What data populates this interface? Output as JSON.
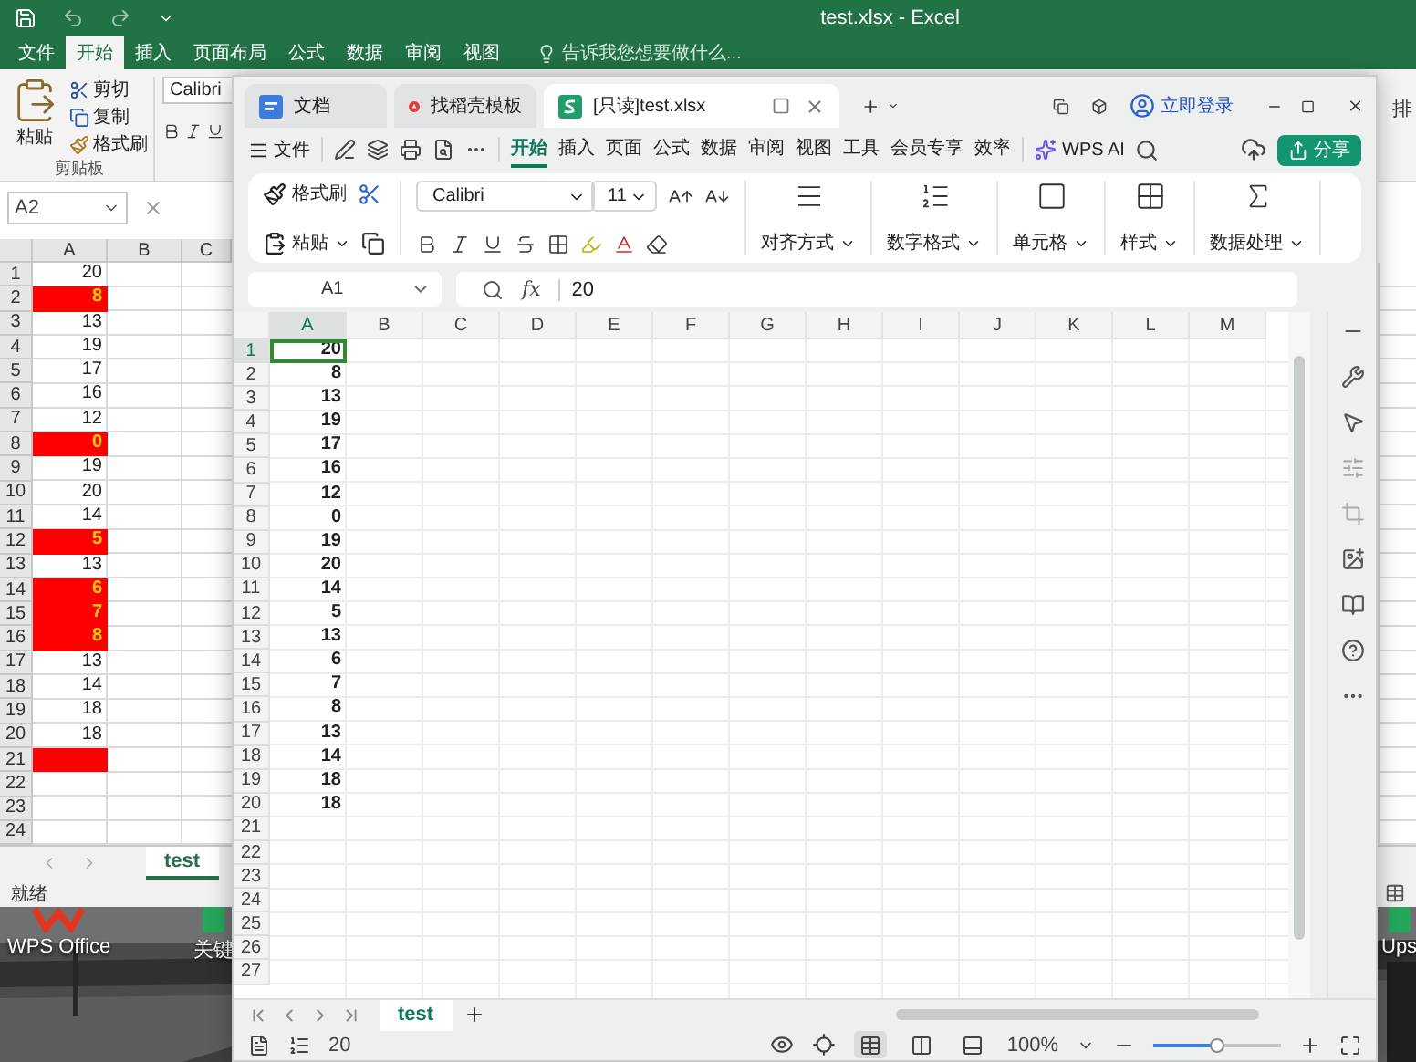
{
  "excel": {
    "title": "test.xlsx - Excel",
    "tabs": [
      {
        "label": "文件",
        "selected": false
      },
      {
        "label": "开始",
        "selected": true
      },
      {
        "label": "插入",
        "selected": false
      },
      {
        "label": "页面布局",
        "selected": false
      },
      {
        "label": "公式",
        "selected": false
      },
      {
        "label": "数据",
        "selected": false
      },
      {
        "label": "审阅",
        "selected": false
      },
      {
        "label": "视图",
        "selected": false
      }
    ],
    "tell_me": "告诉我您想要做什么...",
    "paste": "粘贴",
    "clipboard_items": [
      {
        "label": "剪切",
        "kind": "cut"
      },
      {
        "label": "复制",
        "kind": "copy"
      },
      {
        "label": "格式刷",
        "kind": "painter"
      }
    ],
    "clipboard_group": "剪贴板",
    "font": "Calibri",
    "right_edge_label": "排",
    "name_box": "A2",
    "columns": [
      "A",
      "B",
      "C"
    ],
    "rows": [
      {
        "number": "1",
        "value": "20",
        "highlighted": false
      },
      {
        "number": "2",
        "value": "8",
        "highlighted": true
      },
      {
        "number": "3",
        "value": "13",
        "highlighted": false
      },
      {
        "number": "4",
        "value": "19",
        "highlighted": false
      },
      {
        "number": "5",
        "value": "17",
        "highlighted": false
      },
      {
        "number": "6",
        "value": "16",
        "highlighted": false
      },
      {
        "number": "7",
        "value": "12",
        "highlighted": false
      },
      {
        "number": "8",
        "value": "0",
        "highlighted": true
      },
      {
        "number": "9",
        "value": "19",
        "highlighted": false
      },
      {
        "number": "10",
        "value": "20",
        "highlighted": false
      },
      {
        "number": "11",
        "value": "14",
        "highlighted": false
      },
      {
        "number": "12",
        "value": "5",
        "highlighted": true
      },
      {
        "number": "13",
        "value": "13",
        "highlighted": false
      },
      {
        "number": "14",
        "value": "6",
        "highlighted": true
      },
      {
        "number": "15",
        "value": "7",
        "highlighted": true
      },
      {
        "number": "16",
        "value": "8",
        "highlighted": true
      },
      {
        "number": "17",
        "value": "13",
        "highlighted": false
      },
      {
        "number": "18",
        "value": "14",
        "highlighted": false
      },
      {
        "number": "19",
        "value": "18",
        "highlighted": false
      },
      {
        "number": "20",
        "value": "18",
        "highlighted": false
      },
      {
        "number": "21",
        "highlighted": true
      },
      {
        "number": "22",
        "highlighted": false
      },
      {
        "number": "23",
        "highlighted": false
      },
      {
        "number": "24",
        "highlighted": false
      }
    ],
    "sheet_tab": "test",
    "status": "就绪"
  },
  "desktop": {
    "icons": [
      {
        "label": "WPS Office",
        "kind": "wps"
      },
      {
        "label": "关键",
        "kind": "file"
      },
      {
        "label": "Ups",
        "kind": "file"
      }
    ]
  },
  "wps": {
    "tabs": [
      {
        "label": "文档",
        "kind": "doc",
        "selected": false
      },
      {
        "label": "找稻壳模板",
        "kind": "template",
        "selected": false
      },
      {
        "label": "[只读]test.xlsx",
        "kind": "sheet",
        "selected": true
      }
    ],
    "login": "立即登录",
    "file_menu": "文件",
    "menu": [
      {
        "label": "开始",
        "selected": true
      },
      {
        "label": "插入",
        "selected": false
      },
      {
        "label": "页面",
        "selected": false
      },
      {
        "label": "公式",
        "selected": false
      },
      {
        "label": "数据",
        "selected": false
      },
      {
        "label": "审阅",
        "selected": false
      },
      {
        "label": "视图",
        "selected": false
      },
      {
        "label": "工具",
        "selected": false
      },
      {
        "label": "会员专享",
        "selected": false
      },
      {
        "label": "效率",
        "selected": false
      }
    ],
    "ai": "WPS AI",
    "share": "分享",
    "ribbon": {
      "format_painter": "格式刷",
      "paste": "粘贴",
      "font": "Calibri",
      "size": "11",
      "groups": [
        {
          "label": "对齐方式",
          "kind": "align"
        },
        {
          "label": "数字格式",
          "kind": "number"
        },
        {
          "label": "单元格",
          "kind": "cell"
        },
        {
          "label": "样式",
          "kind": "style"
        },
        {
          "label": "数据处理",
          "kind": "data"
        }
      ]
    },
    "name_box": "A1",
    "function_label": "fx",
    "formula": "20",
    "columns": [
      "A",
      "B",
      "C",
      "D",
      "E",
      "F",
      "G",
      "H",
      "I",
      "J",
      "K",
      "L",
      "M"
    ],
    "rows": [
      {
        "number": "1",
        "value": "20",
        "selected": true
      },
      {
        "number": "2",
        "value": "8",
        "selected": false
      },
      {
        "number": "3",
        "value": "13",
        "selected": false
      },
      {
        "number": "4",
        "value": "19",
        "selected": false
      },
      {
        "number": "5",
        "value": "17",
        "selected": false
      },
      {
        "number": "6",
        "value": "16",
        "selected": false
      },
      {
        "number": "7",
        "value": "12",
        "selected": false
      },
      {
        "number": "8",
        "value": "0",
        "selected": false
      },
      {
        "number": "9",
        "value": "19",
        "selected": false
      },
      {
        "number": "10",
        "value": "20",
        "selected": false
      },
      {
        "number": "11",
        "value": "14",
        "selected": false
      },
      {
        "number": "12",
        "value": "5",
        "selected": false
      },
      {
        "number": "13",
        "value": "13",
        "selected": false
      },
      {
        "number": "14",
        "value": "6",
        "selected": false
      },
      {
        "number": "15",
        "value": "7",
        "selected": false
      },
      {
        "number": "16",
        "value": "8",
        "selected": false
      },
      {
        "number": "17",
        "value": "13",
        "selected": false
      },
      {
        "number": "18",
        "value": "14",
        "selected": false
      },
      {
        "number": "19",
        "value": "18",
        "selected": false
      },
      {
        "number": "20",
        "value": "18",
        "selected": false
      },
      {
        "number": "21",
        "selected": false
      },
      {
        "number": "22",
        "selected": false
      },
      {
        "number": "23",
        "selected": false
      },
      {
        "number": "24",
        "selected": false
      },
      {
        "number": "25",
        "selected": false
      },
      {
        "number": "26",
        "selected": false
      },
      {
        "number": "27",
        "selected": false
      }
    ],
    "sheet_tab": "test",
    "status_count": "20",
    "zoom": "100%",
    "zoom_slider": {
      "level": 0.5
    }
  }
}
